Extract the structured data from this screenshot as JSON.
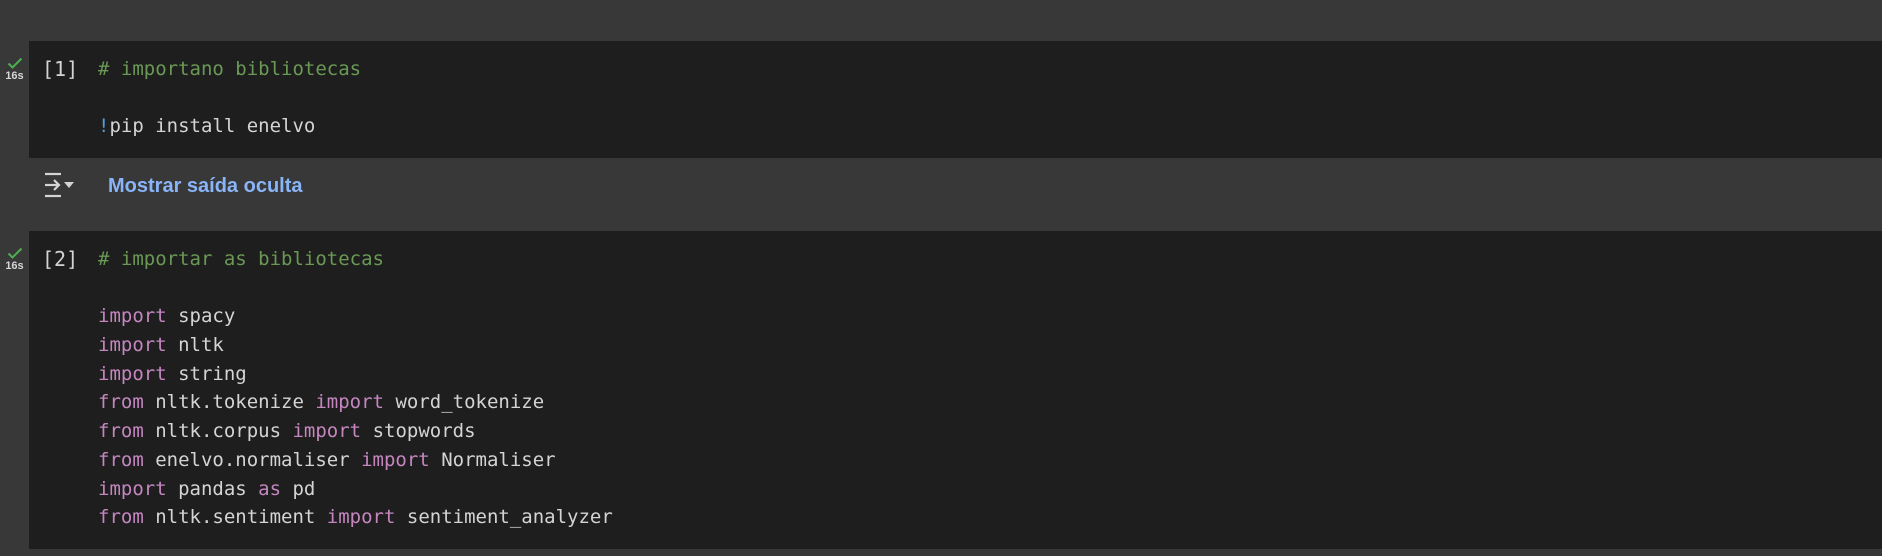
{
  "cells": [
    {
      "prompt": "[1]",
      "duration": "16s",
      "lines": [
        [
          {
            "t": "# importano bibliotecas",
            "c": "cm"
          }
        ],
        [],
        [
          {
            "t": "!",
            "c": "bang"
          },
          {
            "t": "pip install enelvo",
            "c": ""
          }
        ]
      ]
    },
    {
      "prompt": "[2]",
      "duration": "16s",
      "lines": [
        [
          {
            "t": "# importar as bibliotecas",
            "c": "cm"
          }
        ],
        [],
        [
          {
            "t": "import",
            "c": "kw"
          },
          {
            "t": " spacy",
            "c": ""
          }
        ],
        [
          {
            "t": "import",
            "c": "kw"
          },
          {
            "t": " nltk",
            "c": ""
          }
        ],
        [
          {
            "t": "import",
            "c": "kw"
          },
          {
            "t": " string",
            "c": ""
          }
        ],
        [
          {
            "t": "from",
            "c": "kw"
          },
          {
            "t": " nltk.tokenize ",
            "c": ""
          },
          {
            "t": "import",
            "c": "kw"
          },
          {
            "t": " word_tokenize",
            "c": ""
          }
        ],
        [
          {
            "t": "from",
            "c": "kw"
          },
          {
            "t": " nltk.corpus ",
            "c": ""
          },
          {
            "t": "import",
            "c": "kw"
          },
          {
            "t": " stopwords",
            "c": ""
          }
        ],
        [
          {
            "t": "from",
            "c": "kw"
          },
          {
            "t": " enelvo.normaliser ",
            "c": ""
          },
          {
            "t": "import",
            "c": "kw"
          },
          {
            "t": " Normaliser",
            "c": ""
          }
        ],
        [
          {
            "t": "import",
            "c": "kw"
          },
          {
            "t": " pandas ",
            "c": ""
          },
          {
            "t": "as",
            "c": "kw"
          },
          {
            "t": " pd",
            "c": ""
          }
        ],
        [
          {
            "t": "from",
            "c": "kw"
          },
          {
            "t": " nltk.sentiment ",
            "c": ""
          },
          {
            "t": "import",
            "c": "kw"
          },
          {
            "t": " sentiment_analyzer",
            "c": ""
          }
        ]
      ]
    }
  ],
  "output": {
    "label": "Mostrar saída oculta",
    "icon": "output-collapse-icon"
  },
  "colors": {
    "background": "#383838",
    "code_background": "#1e1e1e",
    "comment": "#6a9955",
    "keyword": "#c586c0",
    "link": "#8ab4f8",
    "success": "#4caf50"
  }
}
